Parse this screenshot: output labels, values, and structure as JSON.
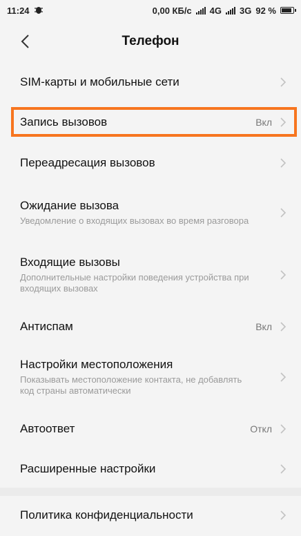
{
  "status_bar": {
    "time": "11:24",
    "speed": "0,00 КБ/с",
    "net1": "4G",
    "net2": "3G",
    "battery": "92 %"
  },
  "header": {
    "title": "Телефон"
  },
  "items": [
    {
      "label": "SIM-карты и мобильные сети",
      "sub": "",
      "value": ""
    },
    {
      "label": "Запись вызовов",
      "sub": "",
      "value": "Вкл"
    },
    {
      "label": "Переадресация вызовов",
      "sub": "",
      "value": ""
    },
    {
      "label": "Ожидание вызова",
      "sub": "Уведомление о входящих вызовах во время разговора",
      "value": ""
    },
    {
      "label": "Входящие вызовы",
      "sub": "Дополнительные настройки поведения устройства при входящих вызовах",
      "value": ""
    },
    {
      "label": "Антиспам",
      "sub": "",
      "value": "Вкл"
    },
    {
      "label": "Настройки местоположения",
      "sub": "Показывать местоположение контакта, не добавлять код страны автоматически",
      "value": ""
    },
    {
      "label": "Автоответ",
      "sub": "",
      "value": "Откл"
    },
    {
      "label": "Расширенные настройки",
      "sub": "",
      "value": ""
    },
    {
      "label": "Политика конфиденциальности",
      "sub": "",
      "value": ""
    }
  ],
  "colors": {
    "highlight": "#f7751f",
    "background": "#f4f4f4"
  }
}
